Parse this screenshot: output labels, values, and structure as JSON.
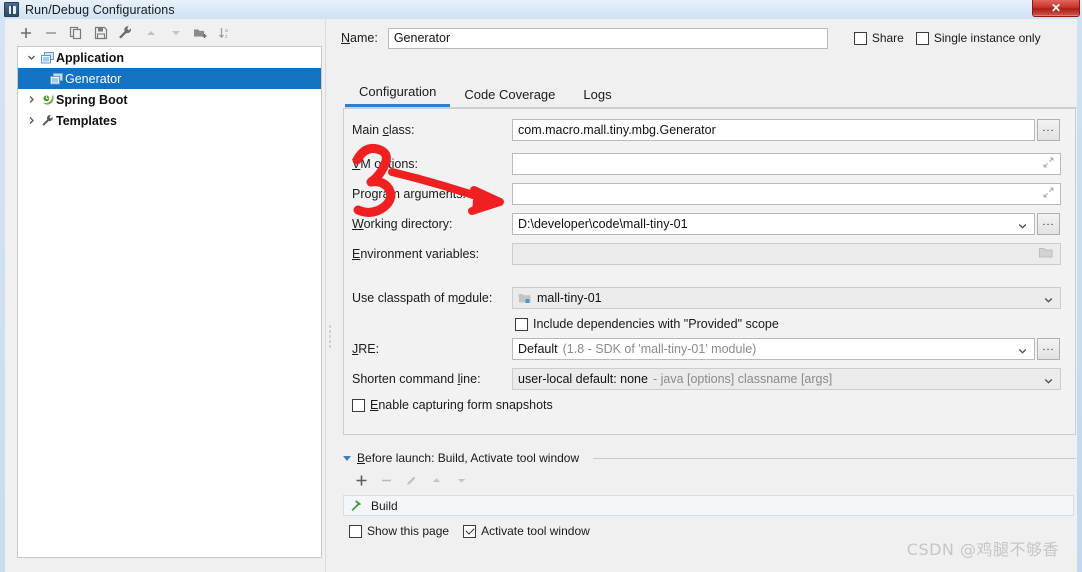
{
  "window": {
    "title": "Run/Debug Configurations",
    "close_label": "✕",
    "icon": "idea-window-icon"
  },
  "sidebar": {
    "toolbar": [
      {
        "name": "add-button",
        "icon": "plus-icon",
        "label": "+"
      },
      {
        "name": "remove-button",
        "icon": "minus-icon",
        "label": "−"
      },
      {
        "name": "copy-button",
        "icon": "copy-icon",
        "label": "Copy"
      },
      {
        "name": "save-button",
        "icon": "save-icon",
        "label": "Save"
      },
      {
        "name": "edit-templates-button",
        "icon": "wrench-icon",
        "label": "Edit Templates"
      },
      {
        "name": "move-up-button",
        "icon": "arrow-up-icon",
        "label": "Move Up"
      },
      {
        "name": "move-down-button",
        "icon": "arrow-down-icon",
        "label": "Move Down"
      },
      {
        "name": "move-into-folder-button",
        "icon": "folder-add-icon",
        "label": "Move into new folder"
      },
      {
        "name": "sort-button",
        "icon": "sort-alpha-icon",
        "label": "Sort configurations"
      }
    ],
    "tree": [
      {
        "label": "Application",
        "icon": "application-icon",
        "twisty": "chevron-down-icon",
        "level": 0,
        "selected": false
      },
      {
        "label": "Generator",
        "icon": "application-icon",
        "twisty": "",
        "level": 1,
        "selected": true
      },
      {
        "label": "Spring Boot",
        "icon": "spring-boot-icon",
        "twisty": "chevron-right-icon",
        "level": 0,
        "selected": false
      },
      {
        "label": "Templates",
        "icon": "wrench-icon",
        "twisty": "chevron-right-icon",
        "level": 0,
        "selected": false
      }
    ]
  },
  "header": {
    "name_label": "Name:",
    "name_value": "Generator",
    "share_label": "Share",
    "share_checked": false,
    "single_instance_label": "Single instance only",
    "single_instance_checked": false
  },
  "tabs": [
    {
      "label": "Configuration",
      "active": true
    },
    {
      "label": "Code Coverage",
      "active": false
    },
    {
      "label": "Logs",
      "active": false
    }
  ],
  "form": {
    "main_class_label": "Main class:",
    "main_class_value": "com.macro.mall.tiny.mbg.Generator",
    "vm_options_label": "VM options:",
    "vm_options_value": "",
    "program_arguments_label": "Program arguments:",
    "program_arguments_value": "",
    "working_directory_label": "Working directory:",
    "working_directory_value": "D:\\developer\\code\\mall-tiny-01",
    "environment_variables_label": "Environment variables:",
    "environment_variables_value": "",
    "classpath_label": "Use classpath of module:",
    "classpath_value": "mall-tiny-01",
    "include_provided_label": "Include dependencies with \"Provided\" scope",
    "include_provided_checked": false,
    "jre_label": "JRE:",
    "jre_value": "Default",
    "jre_hint": "(1.8 - SDK of 'mall-tiny-01' module)",
    "shorten_label": "Shorten command line:",
    "shorten_value": "user-local default: none",
    "shorten_hint": "- java [options] classname [args]",
    "snapshots_label": "Enable capturing form snapshots",
    "snapshots_checked": false,
    "browse_label": "..."
  },
  "before_launch": {
    "title": "Before launch: Build, Activate tool window",
    "toolbar": [
      {
        "name": "add-task-button",
        "icon": "plus-icon"
      },
      {
        "name": "remove-task-button",
        "icon": "minus-icon"
      },
      {
        "name": "edit-task-button",
        "icon": "pencil-icon"
      },
      {
        "name": "task-up-button",
        "icon": "arrow-up-icon"
      },
      {
        "name": "task-down-button",
        "icon": "arrow-down-icon"
      }
    ],
    "tasks": [
      {
        "label": "Build",
        "icon": "hammer-icon"
      }
    ],
    "show_page_label": "Show this page",
    "show_page_checked": false,
    "activate_tool_window_label": "Activate tool window",
    "activate_tool_window_checked": true
  },
  "annotation": {
    "marker_text": "3",
    "color": "#f02020",
    "arrow_target": "working-directory-field"
  },
  "watermark": "CSDN @鸡腿不够香",
  "colors": {
    "accent": "#2a7fd4",
    "selection": "#1372c4",
    "close_button": "#c9342b",
    "annotation_red": "#f02020"
  }
}
